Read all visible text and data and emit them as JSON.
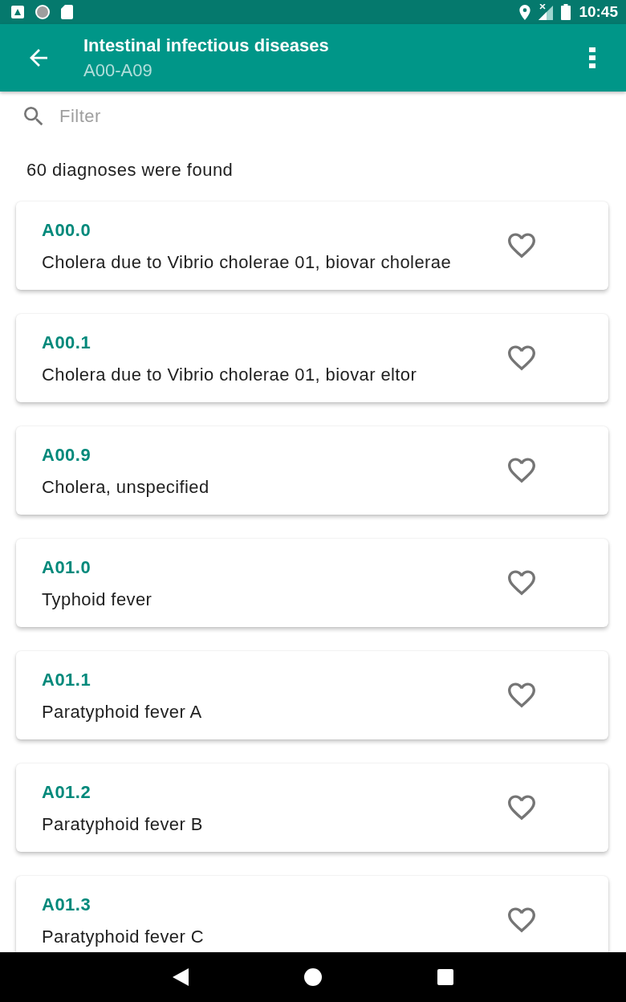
{
  "status_bar": {
    "time": "10:45"
  },
  "app_bar": {
    "title": "Intestinal infectious diseases",
    "subtitle": "A00-A09"
  },
  "filter": {
    "placeholder": "Filter"
  },
  "result_count": "60 diagnoses were found",
  "diagnoses": [
    {
      "code": "A00.0",
      "name": "Cholera due to Vibrio cholerae 01, biovar cholerae",
      "favorite": false
    },
    {
      "code": "A00.1",
      "name": "Cholera due to Vibrio cholerae 01, biovar eltor",
      "favorite": false
    },
    {
      "code": "A00.9",
      "name": "Cholera, unspecified",
      "favorite": false
    },
    {
      "code": "A01.0",
      "name": "Typhoid fever",
      "favorite": false
    },
    {
      "code": "A01.1",
      "name": "Paratyphoid fever A",
      "favorite": false
    },
    {
      "code": "A01.2",
      "name": "Paratyphoid fever B",
      "favorite": false
    },
    {
      "code": "A01.3",
      "name": "Paratyphoid fever C",
      "favorite": false
    }
  ]
}
